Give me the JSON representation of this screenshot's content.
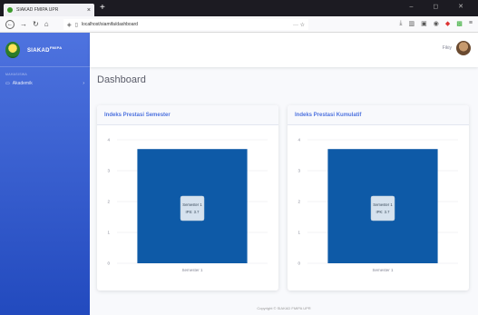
{
  "browser": {
    "tab_title": "SIAKAD FMIPA UPR",
    "tab_close": "×",
    "new_tab": "+",
    "url": "localhost/siamifa/dashboard",
    "url_actions": "··· ☆",
    "window_controls": "– ◻ ✕"
  },
  "sidebar": {
    "brand": "SIAKAD",
    "brand_sup": "FMIPA",
    "heading": "MAHASISWA",
    "items": [
      {
        "label": "Akademik",
        "icon": "folder-icon",
        "chevron": "›"
      }
    ]
  },
  "topbar": {
    "user_name": "Fikiy"
  },
  "page": {
    "title": "Dashboard"
  },
  "cards": [
    {
      "title": "Indeks Prestasi Semester",
      "chart_data": {
        "type": "bar",
        "categories": [
          "Semester 1"
        ],
        "series": [
          {
            "values": [
              3.7
            ]
          }
        ],
        "ylim": [
          0,
          4
        ],
        "yticks": [
          0,
          1,
          2,
          3,
          4
        ],
        "tooltip": {
          "title": "Semester 1",
          "text": "IPS: 3.7"
        },
        "color": "#0e5aa7"
      }
    },
    {
      "title": "Indeks Prestasi Kumulatif",
      "chart_data": {
        "type": "bar",
        "categories": [
          "Semester 1"
        ],
        "series": [
          {
            "values": [
              3.7
            ]
          }
        ],
        "ylim": [
          0,
          4
        ],
        "yticks": [
          0,
          1,
          2,
          3,
          4
        ],
        "tooltip": {
          "title": "Semester 1",
          "text": "IPK: 3.7"
        },
        "color": "#0e5aa7"
      }
    }
  ],
  "footer": {
    "text": "Copyright © SIAKAD FMIPA UPR"
  }
}
